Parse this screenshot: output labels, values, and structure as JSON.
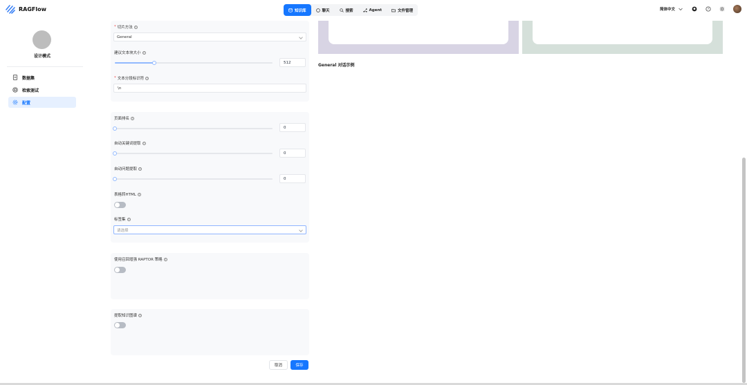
{
  "app": {
    "name": "RAGFlow"
  },
  "nav": [
    {
      "label": "知识库",
      "icon": "database-icon",
      "active": true
    },
    {
      "label": "聊天",
      "icon": "chat-icon",
      "active": false
    },
    {
      "label": "搜索",
      "icon": "search-icon",
      "active": false
    },
    {
      "label": "Agent",
      "icon": "agent-icon",
      "active": false
    },
    {
      "label": "文件管理",
      "icon": "folder-icon",
      "active": false
    }
  ],
  "header": {
    "language": "简体中文"
  },
  "sidebar": {
    "kb_name": "设计模式",
    "items": [
      {
        "label": "数据集",
        "icon": "file-icon",
        "active": false
      },
      {
        "label": "检索测试",
        "icon": "target-icon",
        "active": false
      },
      {
        "label": "配置",
        "icon": "gear-icon",
        "active": true
      }
    ]
  },
  "form": {
    "chunk_method": {
      "label": "切片方法",
      "value": "General"
    },
    "chunk_size": {
      "label": "建议文本块大小",
      "value": "512",
      "fraction": 0.25
    },
    "delimiter": {
      "label": "文本分段标识符",
      "value": "\\n"
    },
    "page_rank": {
      "label": "页面排名",
      "value": "0"
    },
    "auto_keywords": {
      "label": "自动关键词提取",
      "value": "0"
    },
    "auto_questions": {
      "label": "自动问题提取",
      "value": "0"
    },
    "html4excel": {
      "label": "表格转HTML"
    },
    "tags": {
      "label": "标签集",
      "placeholder": "请选择"
    },
    "raptor": {
      "label": "使用召回增强 RAPTOR 策略"
    },
    "graphrag": {
      "label": "提取知识图谱"
    }
  },
  "buttons": {
    "cancel": "取消",
    "save": "保存"
  },
  "preview": {
    "example_title": "General 对话示例"
  },
  "colors": {
    "accent": "#1677ff",
    "preview_left": "#d8d4e4",
    "preview_right": "#d5e0da"
  }
}
